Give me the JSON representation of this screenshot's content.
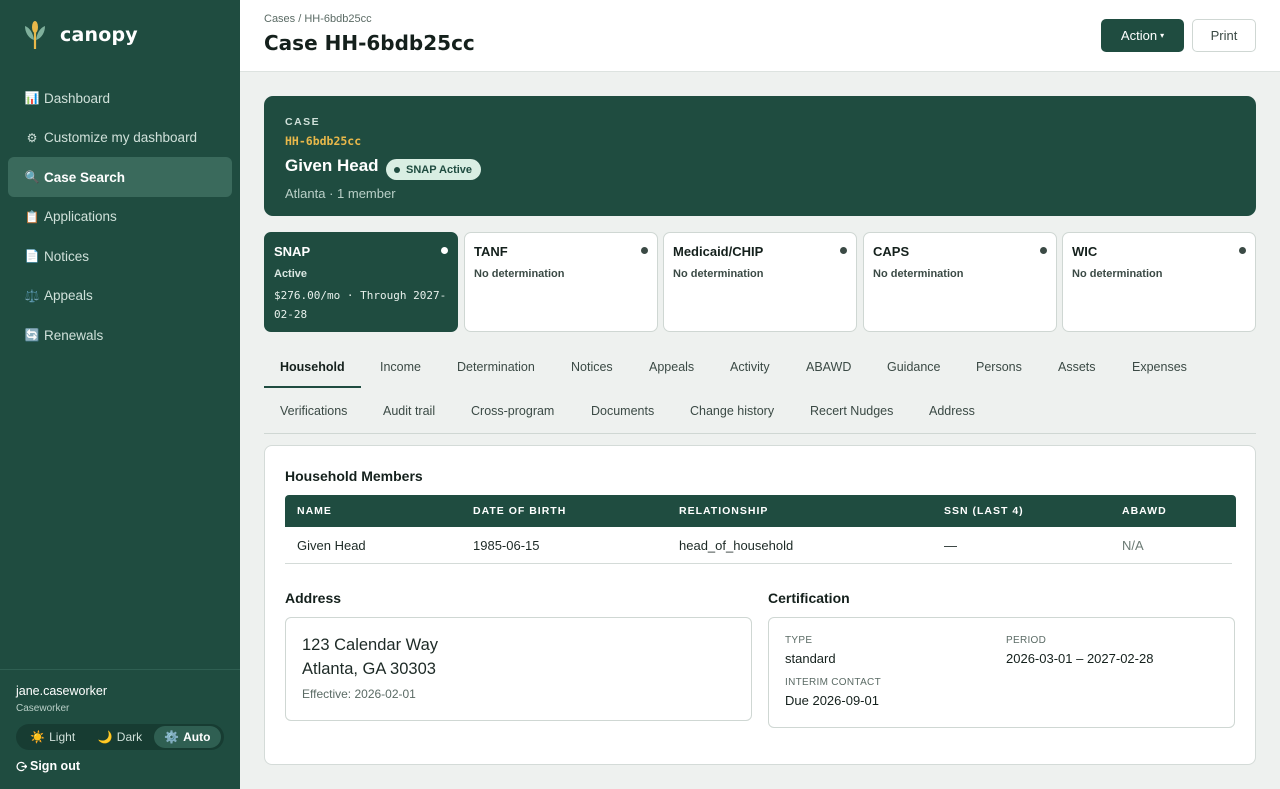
{
  "app": {
    "name": "canopy"
  },
  "sidebar": {
    "items": [
      {
        "icon": "📊",
        "label": "Dashboard"
      },
      {
        "icon": "⚙",
        "label": "Customize my dashboard"
      },
      {
        "icon": "🔍",
        "label": "Case Search"
      },
      {
        "icon": "📋",
        "label": "Applications"
      },
      {
        "icon": "📄",
        "label": "Notices"
      },
      {
        "icon": "⚖️",
        "label": "Appeals"
      },
      {
        "icon": "🔄",
        "label": "Renewals"
      }
    ],
    "active_index": 2
  },
  "user": {
    "name": "jane.caseworker",
    "role": "Caseworker",
    "theme_options": [
      {
        "icon": "☀️",
        "label": "Light"
      },
      {
        "icon": "🌙",
        "label": "Dark"
      },
      {
        "icon": "⚙️",
        "label": "Auto"
      }
    ],
    "theme_selected": "Auto",
    "sign_out": "Sign out"
  },
  "header": {
    "breadcrumb": "Cases / HH-6bdb25cc",
    "title": "Case HH-6bdb25cc",
    "action_label": "Action",
    "print_label": "Print"
  },
  "case": {
    "label": "CASE",
    "id": "HH-6bdb25cc",
    "head_name": "Given Head",
    "badge": "SNAP Active",
    "meta": "Atlanta · 1 member"
  },
  "programs": [
    {
      "name": "SNAP",
      "status": "Active",
      "detail": "$276.00/mo · Through 2027-02-28",
      "active": true
    },
    {
      "name": "TANF",
      "status": "No determination"
    },
    {
      "name": "Medicaid/CHIP",
      "status": "No determination"
    },
    {
      "name": "CAPS",
      "status": "No determination"
    },
    {
      "name": "WIC",
      "status": "No determination"
    }
  ],
  "tabs": {
    "row1": [
      "Household",
      "Income",
      "Determination",
      "Notices",
      "Appeals",
      "Activity",
      "ABAWD",
      "Guidance",
      "Persons",
      "Assets",
      "Expenses"
    ],
    "row2": [
      "Verifications",
      "Audit trail",
      "Cross-program",
      "Documents",
      "Change history",
      "Recert Nudges",
      "Address"
    ],
    "active": "Household"
  },
  "household": {
    "title": "Household Members",
    "columns": [
      "NAME",
      "DATE OF BIRTH",
      "RELATIONSHIP",
      "SSN (LAST 4)",
      "ABAWD"
    ],
    "rows": [
      [
        "Given Head",
        "1985-06-15",
        "head_of_household",
        "—",
        "N/A"
      ]
    ]
  },
  "address": {
    "title": "Address",
    "line1": "123 Calendar Way",
    "line2": "Atlanta, GA 30303",
    "effective": "Effective: 2026-02-01"
  },
  "certification": {
    "title": "Certification",
    "type_label": "TYPE",
    "type_value": "standard",
    "period_label": "PERIOD",
    "period_value": "2026-03-01 – 2027-02-28",
    "interim_label": "INTERIM CONTACT",
    "interim_value": "Due 2026-09-01"
  },
  "colors": {
    "brand": "#1f4c40",
    "accent": "#e8b84a",
    "badge_bg": "#d9eee3"
  }
}
